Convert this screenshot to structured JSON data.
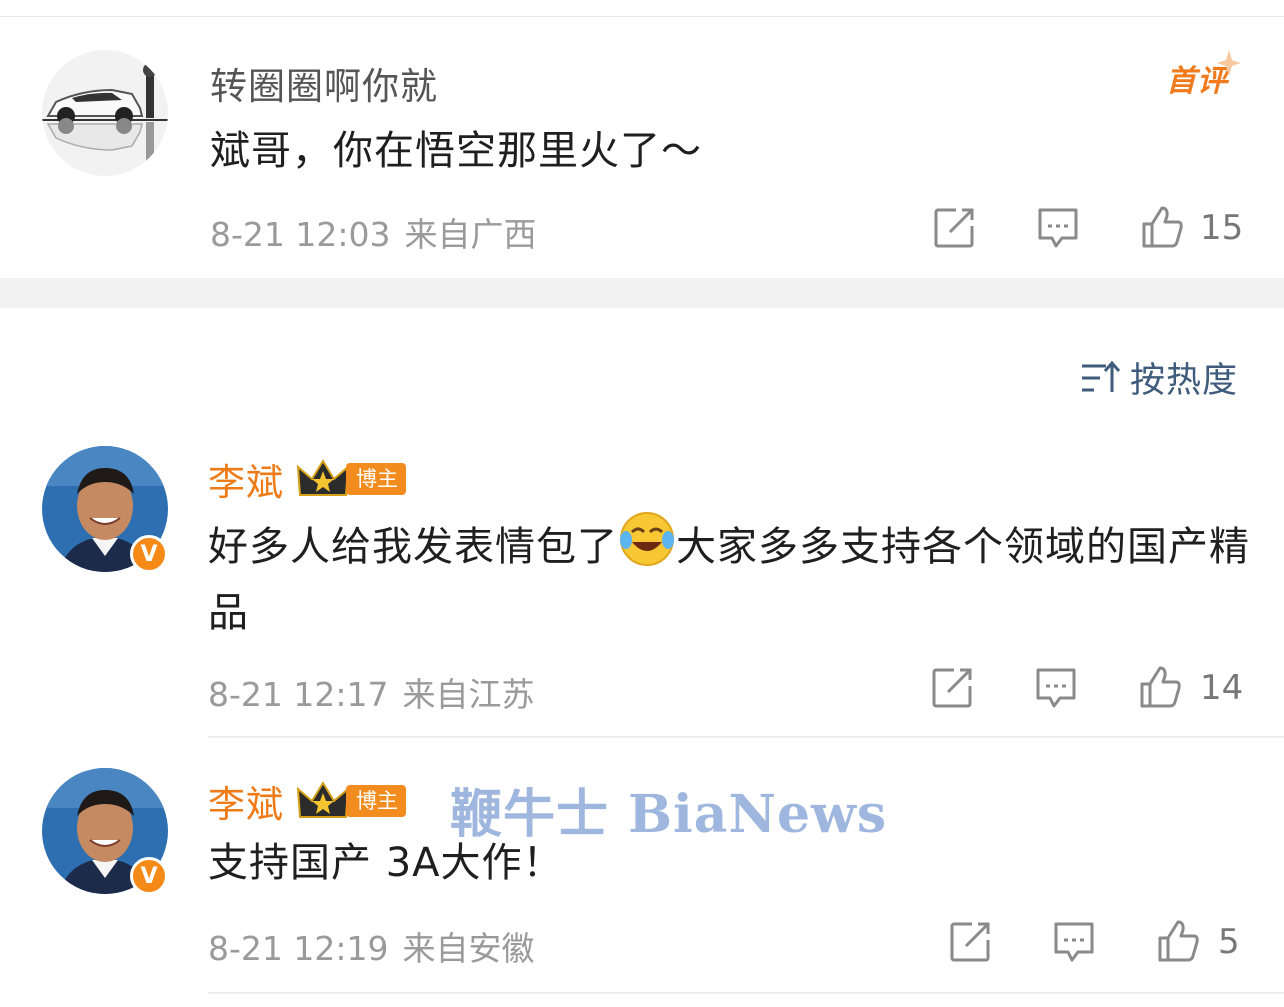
{
  "colors": {
    "accent": "#ee7b17",
    "sort_text": "#3f5c7d",
    "meta": "#9a9a9a",
    "watermark": "#9fb7de"
  },
  "top_comment": {
    "username": "转圈圈啊你就",
    "tag": "首评",
    "text": "斌哥，你在悟空那里火了～",
    "time": "8-21 12:03",
    "location": "来自广西",
    "likes": "15",
    "avatar_icon": "car-avatar-icon"
  },
  "sort": {
    "label": "按热度",
    "icon": "sort-icon"
  },
  "replies": [
    {
      "username": "李斌",
      "badge": "博主",
      "text_before": "好多人给我发表情包了",
      "emoji": "laughing-crying-emoji",
      "text_after": "大家多多支持各个领域的国产精品",
      "time": "8-21 12:17",
      "location": "来自江苏",
      "likes": "14",
      "verified": "V"
    },
    {
      "username": "李斌",
      "badge": "博主",
      "text": "支持国产 3A大作！",
      "time": "8-21 12:19",
      "location": "来自安徽",
      "likes": "5",
      "verified": "V"
    }
  ],
  "watermark": "鞭牛士 BiaNews"
}
